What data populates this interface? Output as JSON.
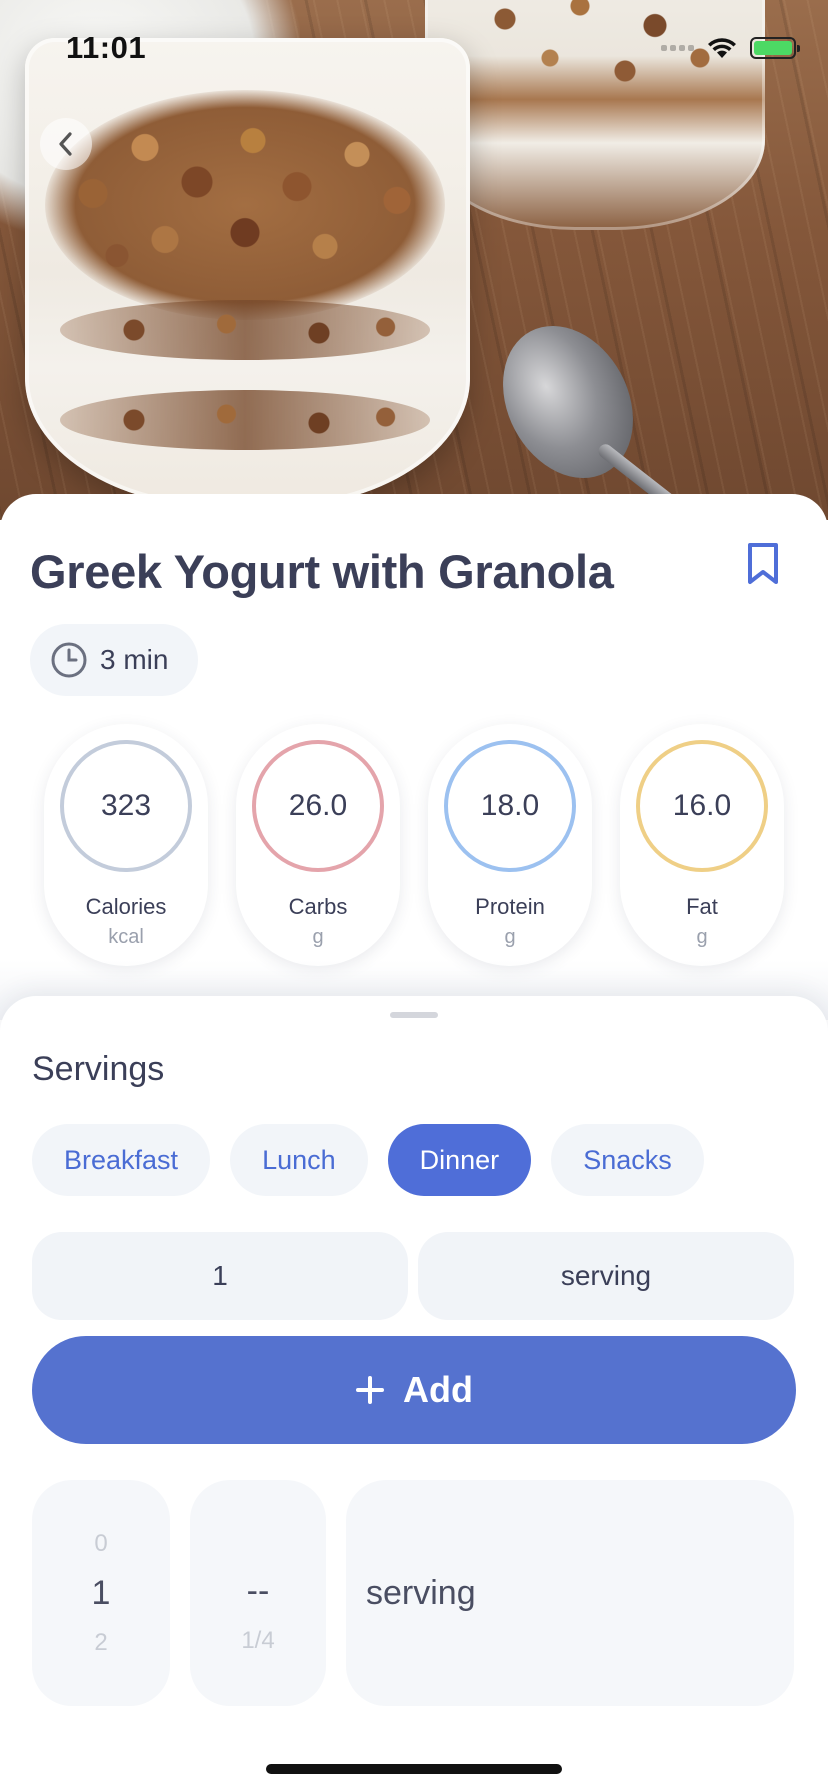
{
  "status_bar": {
    "time": "11:01"
  },
  "recipe": {
    "title": "Greek Yogurt with Granola",
    "prep_time": "3 min"
  },
  "nutrients": [
    {
      "value": "323",
      "label": "Calories",
      "unit": "kcal",
      "color": "#c3ccdb"
    },
    {
      "value": "26.0",
      "label": "Carbs",
      "unit": "g",
      "color": "#e4a4ab"
    },
    {
      "value": "18.0",
      "label": "Protein",
      "unit": "g",
      "color": "#9cc1f0"
    },
    {
      "value": "16.0",
      "label": "Fat",
      "unit": "g",
      "color": "#efcf86"
    }
  ],
  "servings": {
    "title": "Servings",
    "meals": [
      "Breakfast",
      "Lunch",
      "Dinner",
      "Snacks"
    ],
    "selected_meal": "Dinner",
    "quantity": "1",
    "unit": "serving",
    "add_label": "Add"
  },
  "picker": {
    "whole": {
      "above": "0",
      "selected": "1",
      "below": "2"
    },
    "fraction": {
      "selected": "--",
      "below": "1/4"
    },
    "unit": {
      "selected": "serving"
    }
  },
  "colors": {
    "accent": "#5572cf",
    "chip_text": "#4a6cd4",
    "text": "#3b3f58"
  }
}
